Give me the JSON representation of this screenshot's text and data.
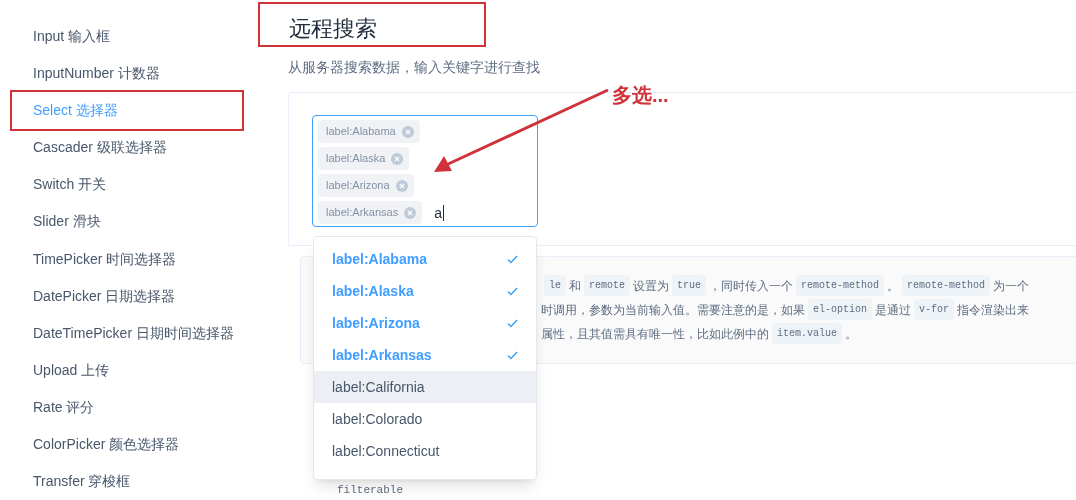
{
  "sidebar": {
    "items": [
      {
        "label": "Input 输入框",
        "selected": false,
        "highlighted": false
      },
      {
        "label": "InputNumber 计数器",
        "selected": false,
        "highlighted": false
      },
      {
        "label": "Select 选择器",
        "selected": true,
        "highlighted": true
      },
      {
        "label": "Cascader 级联选择器",
        "selected": false,
        "highlighted": false
      },
      {
        "label": "Switch 开关",
        "selected": false,
        "highlighted": false
      },
      {
        "label": "Slider 滑块",
        "selected": false,
        "highlighted": false
      },
      {
        "label": "TimePicker 时间选择器",
        "selected": false,
        "highlighted": false
      },
      {
        "label": "DatePicker 日期选择器",
        "selected": false,
        "highlighted": false
      },
      {
        "label": "DateTimePicker 日期时间选择器",
        "selected": false,
        "highlighted": false
      },
      {
        "label": "Upload 上传",
        "selected": false,
        "highlighted": false
      },
      {
        "label": "Rate 评分",
        "selected": false,
        "highlighted": false
      },
      {
        "label": "ColorPicker 颜色选择器",
        "selected": false,
        "highlighted": false
      },
      {
        "label": "Transfer 穿梭框",
        "selected": false,
        "highlighted": false
      }
    ]
  },
  "section": {
    "title": "远程搜索",
    "title_highlighted": true,
    "subtitle": "从服务器搜索数据，输入关键字进行查找"
  },
  "select": {
    "tags": [
      {
        "label": "label:Alabama"
      },
      {
        "label": "label:Alaska"
      },
      {
        "label": "label:Arizona"
      },
      {
        "label": "label:Arkansas"
      }
    ],
    "value": "a"
  },
  "dropdown": {
    "options": [
      {
        "label": "label:Alabama",
        "selected": true,
        "hovered": false
      },
      {
        "label": "label:Alaska",
        "selected": true,
        "hovered": false
      },
      {
        "label": "label:Arizona",
        "selected": true,
        "hovered": false
      },
      {
        "label": "label:Arkansas",
        "selected": true,
        "hovered": false
      },
      {
        "label": "label:California",
        "selected": false,
        "hovered": true
      },
      {
        "label": "label:Colorado",
        "selected": false,
        "hovered": false
      },
      {
        "label": "label:Connecticut",
        "selected": false,
        "hovered": false
      }
    ]
  },
  "annotation": {
    "callout": "多选..."
  },
  "description": {
    "lines": [
      [
        {
          "kind": "code",
          "text": "le"
        },
        {
          "kind": "text",
          "text": "和"
        },
        {
          "kind": "code",
          "text": "remote"
        },
        {
          "kind": "text",
          "text": "设置为"
        },
        {
          "kind": "code",
          "text": "true"
        },
        {
          "kind": "text",
          "text": "，同时传入一个"
        },
        {
          "kind": "code",
          "text": "remote-method"
        },
        {
          "kind": "text",
          "text": "。"
        },
        {
          "kind": "code",
          "text": "remote-method"
        },
        {
          "kind": "text",
          "text": "为一个"
        }
      ],
      [
        {
          "kind": "text",
          "text": "时调用，参数为当前输入值。需要注意的是，如果"
        },
        {
          "kind": "code",
          "text": "el-option"
        },
        {
          "kind": "text",
          "text": "是通过"
        },
        {
          "kind": "code",
          "text": "v-for"
        },
        {
          "kind": "text",
          "text": "指令渲染出来"
        }
      ],
      [
        {
          "kind": "text",
          "text": "属性，且其值需具有唯一性，比如此例中的"
        },
        {
          "kind": "code",
          "text": "item.value"
        },
        {
          "kind": "text",
          "text": "。"
        }
      ]
    ],
    "footer_code": "filterable"
  }
}
